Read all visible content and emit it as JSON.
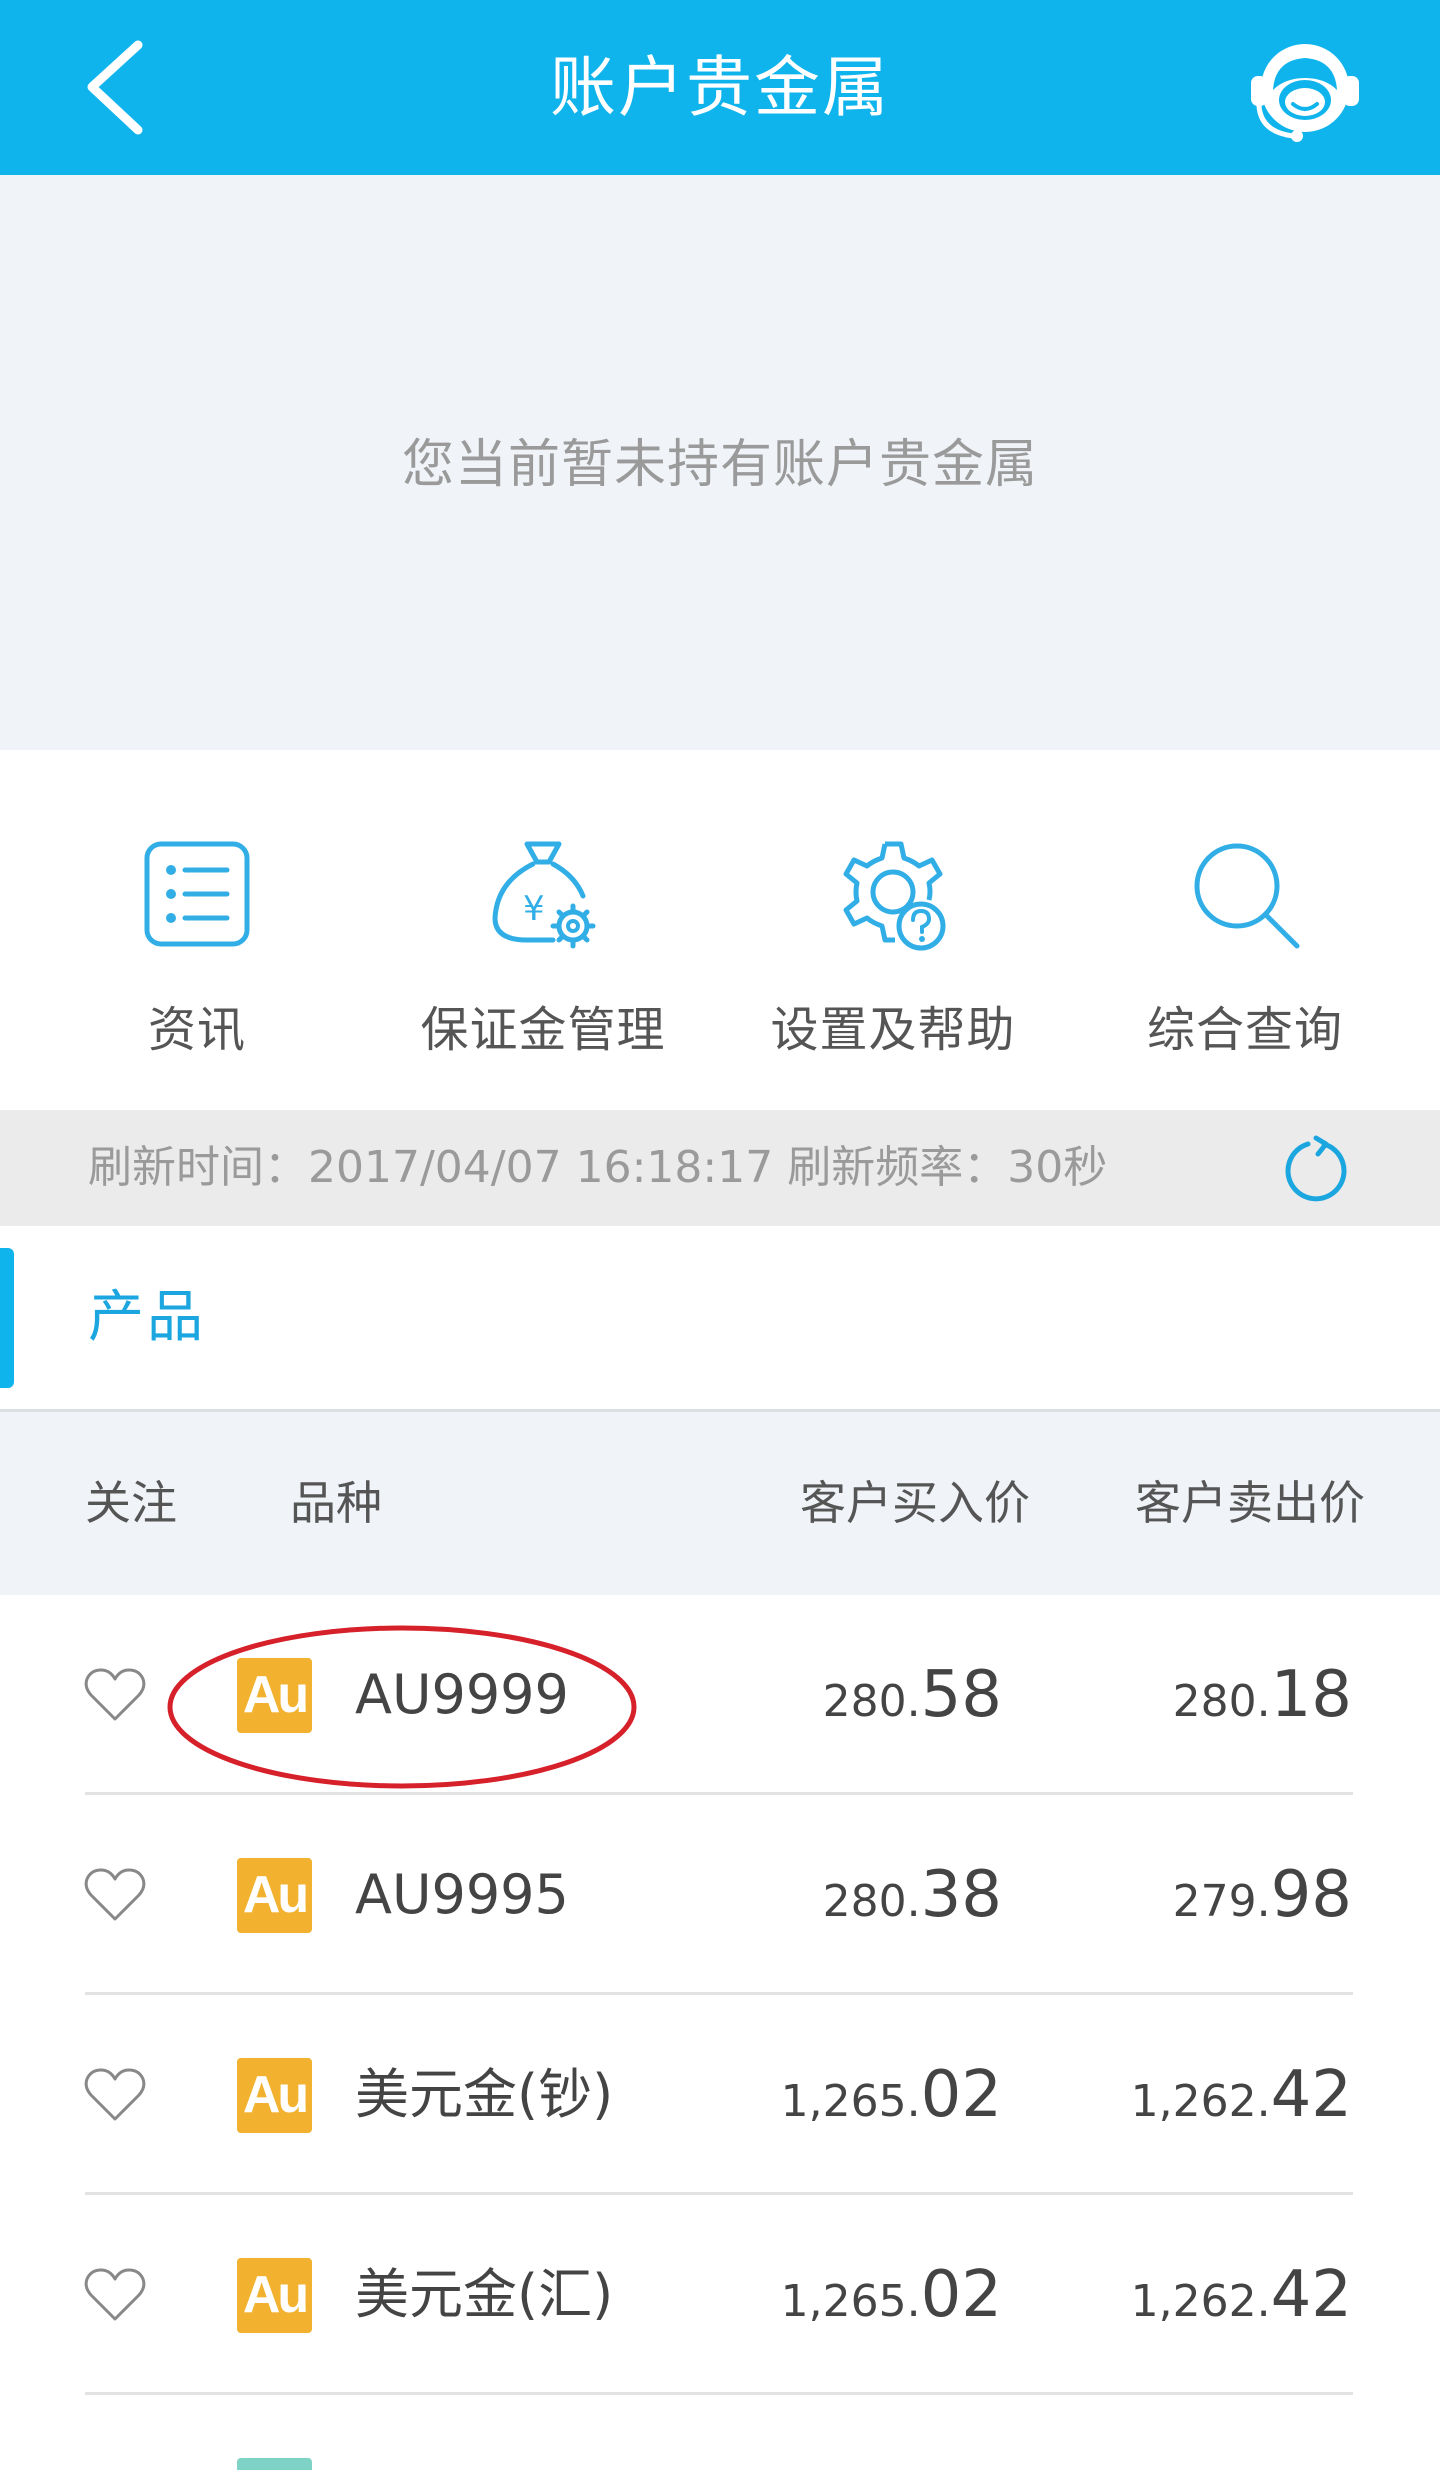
{
  "header": {
    "title": "账户贵金属",
    "back_icon": "chevron-left-icon",
    "service_icon": "customer-service-headset-icon"
  },
  "banner": {
    "empty_text": "您当前暂未持有账户贵金属"
  },
  "quick_actions": [
    {
      "label": "资讯",
      "icon": "list-icon"
    },
    {
      "label": "保证金管理",
      "icon": "money-bag-gear-icon"
    },
    {
      "label": "设置及帮助",
      "icon": "gear-question-icon"
    },
    {
      "label": "综合查询",
      "icon": "search-icon"
    }
  ],
  "refresh": {
    "time_label": "刷新时间：2017/04/07",
    "time_value": "16:18:17",
    "rate_label": "刷新频率：30秒",
    "icon": "refresh-icon"
  },
  "section_tab": {
    "label": "产品"
  },
  "table": {
    "columns": {
      "follow": "关注",
      "kind": "品种",
      "buy": "客户买入价",
      "sell": "客户卖出价"
    }
  },
  "rows": [
    {
      "badge": "Au",
      "name": "AU9999",
      "buy_int": "280.",
      "buy_dec": "58",
      "sell_int": "280.",
      "sell_dec": "18"
    },
    {
      "badge": "Au",
      "name": "AU9995",
      "buy_int": "280.",
      "buy_dec": "38",
      "sell_int": "279.",
      "sell_dec": "98"
    },
    {
      "badge": "Au",
      "name": "美元金(钞)",
      "buy_int": "1,265.",
      "buy_dec": "02",
      "sell_int": "1,262.",
      "sell_dec": "42"
    },
    {
      "badge": "Au",
      "name": "美元金(汇)",
      "buy_int": "1,265.",
      "buy_dec": "02",
      "sell_int": "1,262.",
      "sell_dec": "42"
    }
  ],
  "colors": {
    "header": "#10b4ec",
    "accent": "#1ba6e0",
    "badge_gold": "#f2b230",
    "annotation": "#d6202a"
  }
}
